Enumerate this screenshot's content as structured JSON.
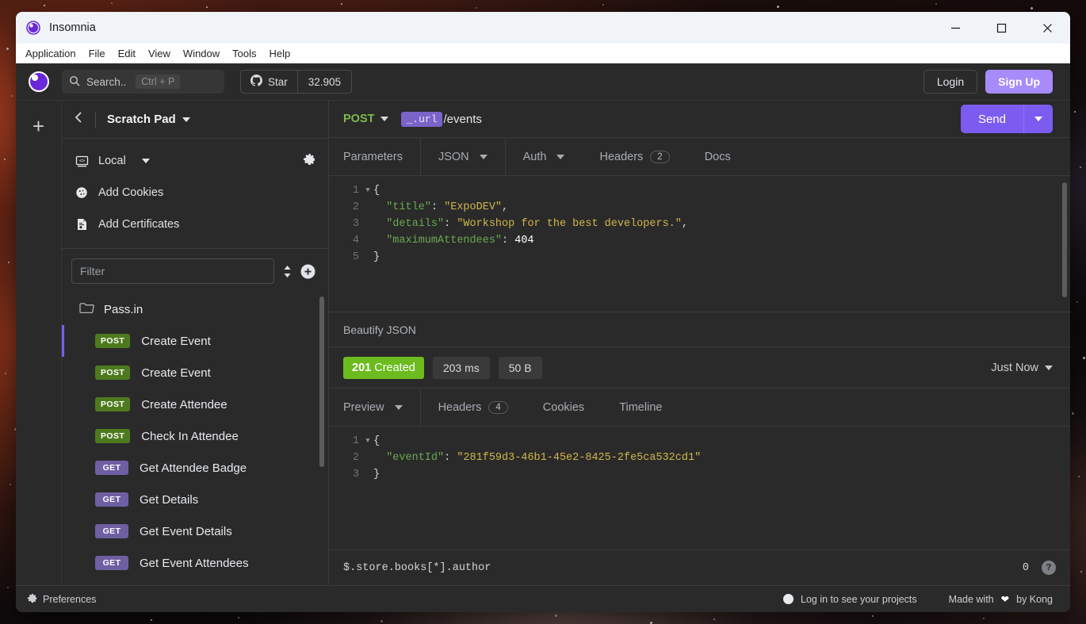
{
  "window": {
    "title": "Insomnia",
    "app_icon": "insomnia-logo-icon",
    "controls": {
      "minimize": "minimize-icon",
      "maximize": "maximize-icon",
      "close": "close-icon"
    }
  },
  "menubar": {
    "items": [
      "Application",
      "File",
      "Edit",
      "View",
      "Window",
      "Tools",
      "Help"
    ]
  },
  "toolbar": {
    "search": {
      "placeholder": "Search..",
      "shortcut": "Ctrl + P"
    },
    "github": {
      "label": "Star",
      "count": "32.905"
    },
    "login_label": "Login",
    "signup_label": "Sign Up"
  },
  "rail": {
    "add_label": "+"
  },
  "sidebar": {
    "back_icon": "chevron-left-icon",
    "workspace": "Scratch Pad",
    "settings_items": [
      {
        "label": "Local",
        "icon": "environment-icon",
        "has_caret": true
      },
      {
        "label": "Add Cookies",
        "icon": "cookie-icon",
        "has_caret": false
      },
      {
        "label": "Add Certificates",
        "icon": "certificate-icon",
        "has_caret": false
      }
    ],
    "filter_placeholder": "Filter",
    "requests": [
      {
        "type": "folder",
        "label": "Pass.in",
        "method": "",
        "active": false
      },
      {
        "type": "request",
        "label": "Create Event",
        "method": "POST",
        "active": true
      },
      {
        "type": "request",
        "label": "Create Event",
        "method": "POST",
        "active": false
      },
      {
        "type": "request",
        "label": "Create Attendee",
        "method": "POST",
        "active": false
      },
      {
        "type": "request",
        "label": "Check In Attendee",
        "method": "POST",
        "active": false
      },
      {
        "type": "request",
        "label": "Get Attendee Badge",
        "method": "GET",
        "active": false
      },
      {
        "type": "request",
        "label": "Get Details",
        "method": "GET",
        "active": false
      },
      {
        "type": "request",
        "label": "Get Event Details",
        "method": "GET",
        "active": false
      },
      {
        "type": "request",
        "label": "Get Event Attendees",
        "method": "GET",
        "active": false
      }
    ]
  },
  "request": {
    "method": "POST",
    "url_template_tag": "_.url",
    "url_path": "/events",
    "send_label": "Send",
    "tabs": [
      {
        "label": "Parameters",
        "caret": false,
        "badge": ""
      },
      {
        "label": "JSON",
        "caret": true,
        "badge": ""
      },
      {
        "label": "Auth",
        "caret": true,
        "badge": ""
      },
      {
        "label": "Headers",
        "caret": false,
        "badge": "2"
      },
      {
        "label": "Docs",
        "caret": false,
        "badge": ""
      }
    ],
    "body_lines": [
      {
        "n": "1",
        "fold": true,
        "segments": [
          {
            "t": "{",
            "c": "p"
          }
        ]
      },
      {
        "n": "2",
        "fold": false,
        "segments": [
          {
            "t": "  \"title\"",
            "c": "k"
          },
          {
            "t": ": ",
            "c": "p"
          },
          {
            "t": "\"ExpoDEV\"",
            "c": "s"
          },
          {
            "t": ",",
            "c": "p"
          }
        ]
      },
      {
        "n": "3",
        "fold": false,
        "segments": [
          {
            "t": "  \"details\"",
            "c": "k"
          },
          {
            "t": ": ",
            "c": "p"
          },
          {
            "t": "\"Workshop for the best developers.\"",
            "c": "s"
          },
          {
            "t": ",",
            "c": "p"
          }
        ]
      },
      {
        "n": "4",
        "fold": false,
        "segments": [
          {
            "t": "  \"maximumAttendees\"",
            "c": "k"
          },
          {
            "t": ": ",
            "c": "p"
          },
          {
            "t": "404",
            "c": "n"
          }
        ]
      },
      {
        "n": "5",
        "fold": false,
        "segments": [
          {
            "t": "}",
            "c": "p"
          }
        ]
      }
    ]
  },
  "beautify_label": "Beautify JSON",
  "response": {
    "status_code": "201",
    "status_text": "Created",
    "time": "203 ms",
    "size": "50 B",
    "history_label": "Just Now",
    "tabs": [
      {
        "label": "Preview",
        "caret": true,
        "badge": ""
      },
      {
        "label": "Headers",
        "caret": false,
        "badge": "4"
      },
      {
        "label": "Cookies",
        "caret": false,
        "badge": ""
      },
      {
        "label": "Timeline",
        "caret": false,
        "badge": ""
      }
    ],
    "body_lines": [
      {
        "n": "1",
        "fold": true,
        "segments": [
          {
            "t": "{",
            "c": "p"
          }
        ]
      },
      {
        "n": "2",
        "fold": false,
        "segments": [
          {
            "t": "  \"eventId\"",
            "c": "k"
          },
          {
            "t": ": ",
            "c": "p"
          },
          {
            "t": "\"281f59d3-46b1-45e2-8425-2fe5ca532cd1\"",
            "c": "s"
          }
        ]
      },
      {
        "n": "3",
        "fold": false,
        "segments": [
          {
            "t": "}",
            "c": "p"
          }
        ]
      }
    ],
    "jsonpath_value": "$.store.books[*].author",
    "jsonpath_count": "0",
    "jsonpath_help": "?"
  },
  "statusbar": {
    "preferences_label": "Preferences",
    "login_hint": "Log in to see your projects",
    "made_with_prefix": "Made with",
    "made_with_suffix": "by Kong"
  },
  "colors": {
    "accent_purple": "#7c5cf0",
    "signup_purple": "#a78bfa",
    "status_green": "#6cbb1f",
    "method_post": "#4e7a1e",
    "method_get": "#6e5fa3",
    "window_bg": "#2a2a2a"
  }
}
